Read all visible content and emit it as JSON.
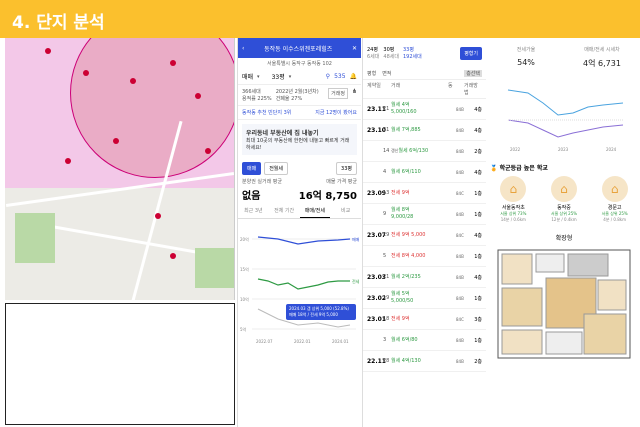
{
  "header": {
    "title": "4. 단지 분석",
    "bg": "#fbc02d"
  },
  "p1": {
    "title": "동작동 이수스위첸포레힐즈",
    "address": "서울특별시 동작구 동작동 102",
    "type_label": "매매",
    "type_size": "33평",
    "count": "535",
    "info1_a": "366세대",
    "info1_b": "2022년 2월(3년차)",
    "info2_a": "용적률 225%",
    "info2_b": "건폐율 27%",
    "info_btn": "거래정",
    "rank_text": "동작동 추천 빈단지 3위",
    "rank_right": "지금 12명이 봤어요",
    "noti_title": "우리동네 부동산에 집 내놓기",
    "noti_body": "최대 10곳의 부동산에 한번에 내놓고 빠르게 거래하세요!",
    "tab_sale": "매매",
    "tab_jeonse": "전월세",
    "size": "33평",
    "avg_label": "분양권 실거래 평균",
    "avg_value": "없음",
    "ask_label": "매물 가격 평균",
    "ask_value": "16억 8,750",
    "periods": [
      "최근 3년",
      "전체 기간",
      "매매/전세",
      "비교"
    ],
    "tooltip_line1": "2024.03 갭 상위 5,000 (52.8%)",
    "tooltip_line2": "매매 18억 / 전세 9억 5,000",
    "y_labels": [
      "20억",
      "15억",
      "10억",
      "5억"
    ],
    "x_labels": [
      "2022.07",
      "2022.01",
      "2024.01"
    ],
    "legend_sale": "매매",
    "legend_jeonse": "전세"
  },
  "p2": {
    "tab1": "24평",
    "tab1b": "6세대",
    "tab2": "30평",
    "tab2b": "48세대",
    "tab3": "33평",
    "tab3b": "192세대",
    "btn": "평형기",
    "sub1": "평형",
    "sub2": "면적",
    "sub3": "층선택",
    "headers": [
      "계약일",
      "층",
      "거래",
      "동",
      "거래방법"
    ],
    "rows": [
      {
        "date": "23.11",
        "d": "21",
        "t1": "월세 4억",
        "t2": "5,000/160",
        "dong": "84B",
        "f": "4층",
        "kind": "monthly"
      },
      {
        "date": "23.10",
        "d": "31",
        "t1": "월세 7억,885",
        "t2": "",
        "dong": "84B",
        "f": "4층",
        "kind": "monthly"
      },
      {
        "date": "",
        "d": "14",
        "t1": "월세 6억/130",
        "t2": "",
        "dong": "84B",
        "f": "2층",
        "kind": "monthly",
        "extra": "갱신"
      },
      {
        "date": "",
        "d": "4",
        "t1": "월세 6억/110",
        "t2": "",
        "dong": "84B",
        "f": "4층",
        "kind": "monthly"
      },
      {
        "date": "23.09",
        "d": "13",
        "t1": "전세 9억",
        "t2": "",
        "dong": "84C",
        "f": "1층",
        "kind": "jeonse"
      },
      {
        "date": "",
        "d": "9",
        "t1": "월세 8억",
        "t2": "9,000/28",
        "dong": "84B",
        "f": "1층",
        "kind": "monthly"
      },
      {
        "date": "23.07",
        "d": "19",
        "t1": "전세 9억 5,000",
        "t2": "",
        "dong": "84C",
        "f": "4층",
        "kind": "jeonse"
      },
      {
        "date": "",
        "d": "5",
        "t1": "전세 8억 4,000",
        "t2": "",
        "dong": "84B",
        "f": "1층",
        "kind": "jeonse"
      },
      {
        "date": "23.03",
        "d": "21",
        "t1": "월세 2억/235",
        "t2": "",
        "dong": "84B",
        "f": "4층",
        "kind": "monthly"
      },
      {
        "date": "23.02",
        "d": "19",
        "t1": "월세 5억",
        "t2": "5,000/50",
        "dong": "84B",
        "f": "1층",
        "kind": "monthly"
      },
      {
        "date": "23.01",
        "d": "18",
        "t1": "전세 9억",
        "t2": "",
        "dong": "84C",
        "f": "3층",
        "kind": "jeonse"
      },
      {
        "date": "",
        "d": "3",
        "t1": "월세 6억/80",
        "t2": "",
        "dong": "84B",
        "f": "1층",
        "kind": "monthly"
      },
      {
        "date": "22.11",
        "d": "28",
        "t1": "월세 4억/130",
        "t2": "",
        "dong": "84B",
        "f": "2층",
        "kind": "monthly"
      }
    ]
  },
  "right": {
    "stat1_label": "전세가율",
    "stat1_value": "54%",
    "stat2_label": "매매/전세 시세차",
    "stat2_value": "4억 6,731",
    "chart_x": [
      "2022",
      "2023",
      "2024"
    ],
    "school_title": "학군등급 높은 학교",
    "schools": [
      {
        "name": "서울동작초",
        "stat": "서울 상위 73%",
        "dist": "14분 / 0.6km"
      },
      {
        "name": "동작중",
        "stat": "서울 상위 25%",
        "dist": "12분 / 0.4km"
      },
      {
        "name": "경문고",
        "stat": "서울 상위 25%",
        "dist": "4분 / 0.8km"
      }
    ],
    "floorplan_title": "확장형"
  }
}
